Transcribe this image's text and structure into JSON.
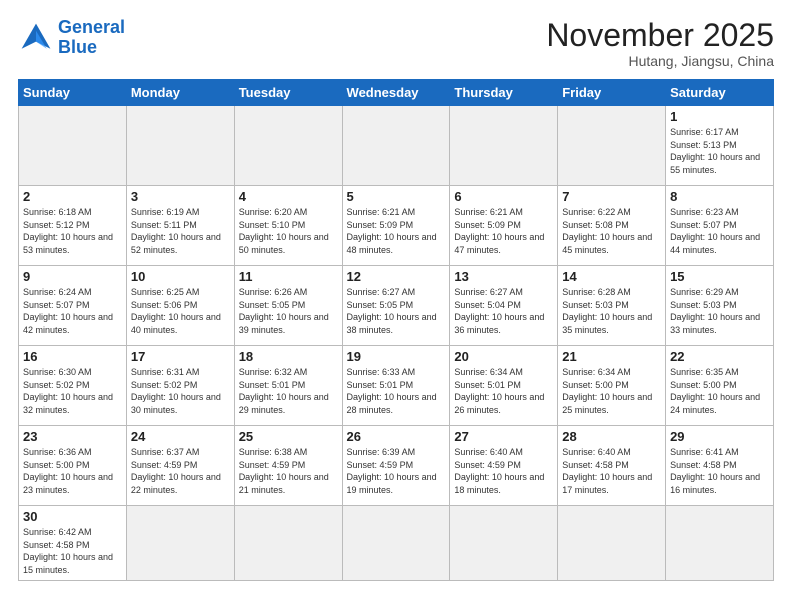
{
  "logo": {
    "line1": "General",
    "line2": "Blue"
  },
  "title": "November 2025",
  "location": "Hutang, Jiangsu, China",
  "weekdays": [
    "Sunday",
    "Monday",
    "Tuesday",
    "Wednesday",
    "Thursday",
    "Friday",
    "Saturday"
  ],
  "weeks": [
    [
      {
        "day": null,
        "info": null
      },
      {
        "day": null,
        "info": null
      },
      {
        "day": null,
        "info": null
      },
      {
        "day": null,
        "info": null
      },
      {
        "day": null,
        "info": null
      },
      {
        "day": null,
        "info": null
      },
      {
        "day": "1",
        "info": "Sunrise: 6:17 AM\nSunset: 5:13 PM\nDaylight: 10 hours\nand 55 minutes."
      }
    ],
    [
      {
        "day": "2",
        "info": "Sunrise: 6:18 AM\nSunset: 5:12 PM\nDaylight: 10 hours\nand 53 minutes."
      },
      {
        "day": "3",
        "info": "Sunrise: 6:19 AM\nSunset: 5:11 PM\nDaylight: 10 hours\nand 52 minutes."
      },
      {
        "day": "4",
        "info": "Sunrise: 6:20 AM\nSunset: 5:10 PM\nDaylight: 10 hours\nand 50 minutes."
      },
      {
        "day": "5",
        "info": "Sunrise: 6:21 AM\nSunset: 5:09 PM\nDaylight: 10 hours\nand 48 minutes."
      },
      {
        "day": "6",
        "info": "Sunrise: 6:21 AM\nSunset: 5:09 PM\nDaylight: 10 hours\nand 47 minutes."
      },
      {
        "day": "7",
        "info": "Sunrise: 6:22 AM\nSunset: 5:08 PM\nDaylight: 10 hours\nand 45 minutes."
      },
      {
        "day": "8",
        "info": "Sunrise: 6:23 AM\nSunset: 5:07 PM\nDaylight: 10 hours\nand 44 minutes."
      }
    ],
    [
      {
        "day": "9",
        "info": "Sunrise: 6:24 AM\nSunset: 5:07 PM\nDaylight: 10 hours\nand 42 minutes."
      },
      {
        "day": "10",
        "info": "Sunrise: 6:25 AM\nSunset: 5:06 PM\nDaylight: 10 hours\nand 40 minutes."
      },
      {
        "day": "11",
        "info": "Sunrise: 6:26 AM\nSunset: 5:05 PM\nDaylight: 10 hours\nand 39 minutes."
      },
      {
        "day": "12",
        "info": "Sunrise: 6:27 AM\nSunset: 5:05 PM\nDaylight: 10 hours\nand 38 minutes."
      },
      {
        "day": "13",
        "info": "Sunrise: 6:27 AM\nSunset: 5:04 PM\nDaylight: 10 hours\nand 36 minutes."
      },
      {
        "day": "14",
        "info": "Sunrise: 6:28 AM\nSunset: 5:03 PM\nDaylight: 10 hours\nand 35 minutes."
      },
      {
        "day": "15",
        "info": "Sunrise: 6:29 AM\nSunset: 5:03 PM\nDaylight: 10 hours\nand 33 minutes."
      }
    ],
    [
      {
        "day": "16",
        "info": "Sunrise: 6:30 AM\nSunset: 5:02 PM\nDaylight: 10 hours\nand 32 minutes."
      },
      {
        "day": "17",
        "info": "Sunrise: 6:31 AM\nSunset: 5:02 PM\nDaylight: 10 hours\nand 30 minutes."
      },
      {
        "day": "18",
        "info": "Sunrise: 6:32 AM\nSunset: 5:01 PM\nDaylight: 10 hours\nand 29 minutes."
      },
      {
        "day": "19",
        "info": "Sunrise: 6:33 AM\nSunset: 5:01 PM\nDaylight: 10 hours\nand 28 minutes."
      },
      {
        "day": "20",
        "info": "Sunrise: 6:34 AM\nSunset: 5:01 PM\nDaylight: 10 hours\nand 26 minutes."
      },
      {
        "day": "21",
        "info": "Sunrise: 6:34 AM\nSunset: 5:00 PM\nDaylight: 10 hours\nand 25 minutes."
      },
      {
        "day": "22",
        "info": "Sunrise: 6:35 AM\nSunset: 5:00 PM\nDaylight: 10 hours\nand 24 minutes."
      }
    ],
    [
      {
        "day": "23",
        "info": "Sunrise: 6:36 AM\nSunset: 5:00 PM\nDaylight: 10 hours\nand 23 minutes."
      },
      {
        "day": "24",
        "info": "Sunrise: 6:37 AM\nSunset: 4:59 PM\nDaylight: 10 hours\nand 22 minutes."
      },
      {
        "day": "25",
        "info": "Sunrise: 6:38 AM\nSunset: 4:59 PM\nDaylight: 10 hours\nand 21 minutes."
      },
      {
        "day": "26",
        "info": "Sunrise: 6:39 AM\nSunset: 4:59 PM\nDaylight: 10 hours\nand 19 minutes."
      },
      {
        "day": "27",
        "info": "Sunrise: 6:40 AM\nSunset: 4:59 PM\nDaylight: 10 hours\nand 18 minutes."
      },
      {
        "day": "28",
        "info": "Sunrise: 6:40 AM\nSunset: 4:58 PM\nDaylight: 10 hours\nand 17 minutes."
      },
      {
        "day": "29",
        "info": "Sunrise: 6:41 AM\nSunset: 4:58 PM\nDaylight: 10 hours\nand 16 minutes."
      }
    ],
    [
      {
        "day": "30",
        "info": "Sunrise: 6:42 AM\nSunset: 4:58 PM\nDaylight: 10 hours\nand 15 minutes."
      },
      {
        "day": null,
        "info": null
      },
      {
        "day": null,
        "info": null
      },
      {
        "day": null,
        "info": null
      },
      {
        "day": null,
        "info": null
      },
      {
        "day": null,
        "info": null
      },
      {
        "day": null,
        "info": null
      }
    ]
  ]
}
